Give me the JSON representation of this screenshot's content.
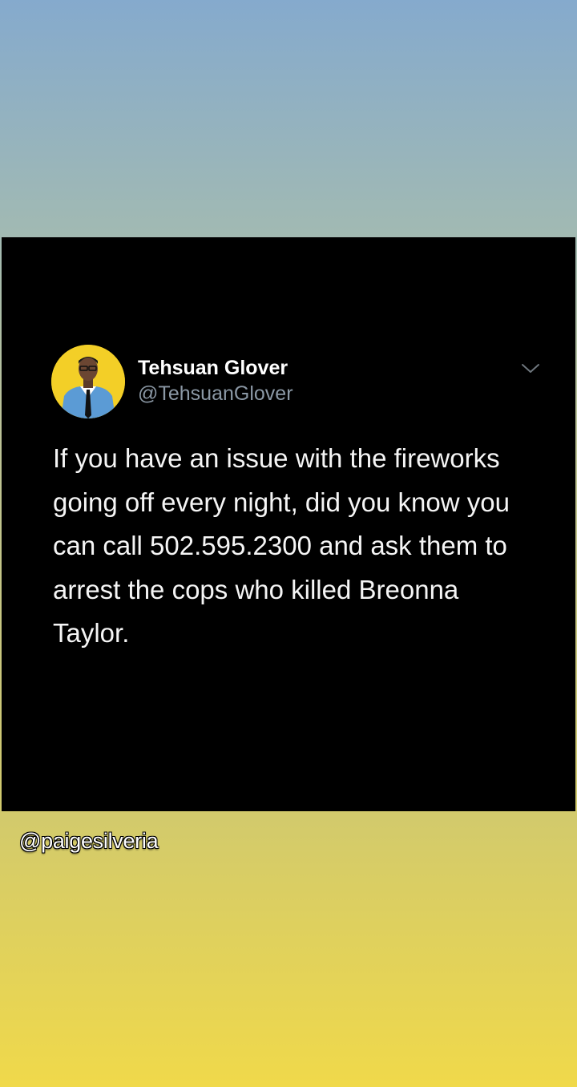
{
  "tweet": {
    "display_name": "Tehsuan Glover",
    "handle": "@TehsuanGlover",
    "text": "If you have an issue with the fireworks going off every night, did you know you can call 502.595.2300 and ask them to arrest the cops who killed Breonna Taylor.",
    "avatar_icon": "profile-photo",
    "menu_icon": "chevron-down-icon"
  },
  "story": {
    "watermark": "@paigesilveria"
  },
  "colors": {
    "card_background": "#000000",
    "handle_gray": "#8b98a5",
    "avatar_background": "#f3cf27",
    "gradient_top": "#85aacd",
    "gradient_bottom": "#f0d94a"
  }
}
